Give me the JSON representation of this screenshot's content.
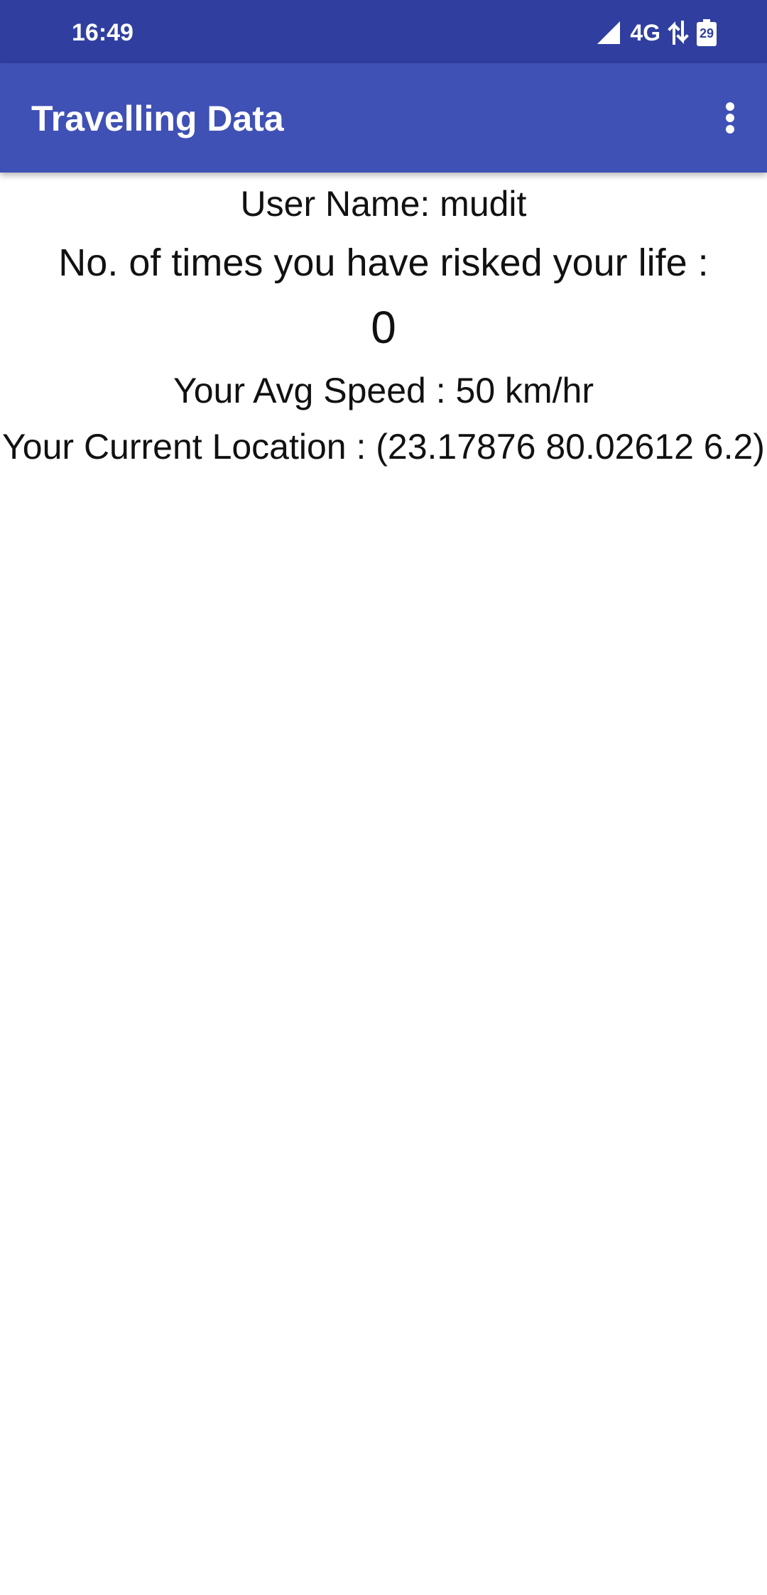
{
  "status_bar": {
    "time": "16:49",
    "network": "4G",
    "battery_level": "29",
    "icons": [
      "signal-icon",
      "data-transfer-icon",
      "battery-icon"
    ]
  },
  "app_bar": {
    "title": "Travelling Data",
    "menu_icon": "more-vert-icon"
  },
  "content": {
    "user_name": "User Name: mudit",
    "risk_label": "No. of times you have risked your life :",
    "risk_count": "0",
    "avg_speed": "Your Avg Speed : 50 km/hr",
    "location": "Your Current Location : (23.17876 80.02612 6.2)"
  },
  "colors": {
    "status_bar": "#303f9f",
    "app_bar": "#3f51b5",
    "text": "#111111",
    "background": "#ffffff"
  }
}
